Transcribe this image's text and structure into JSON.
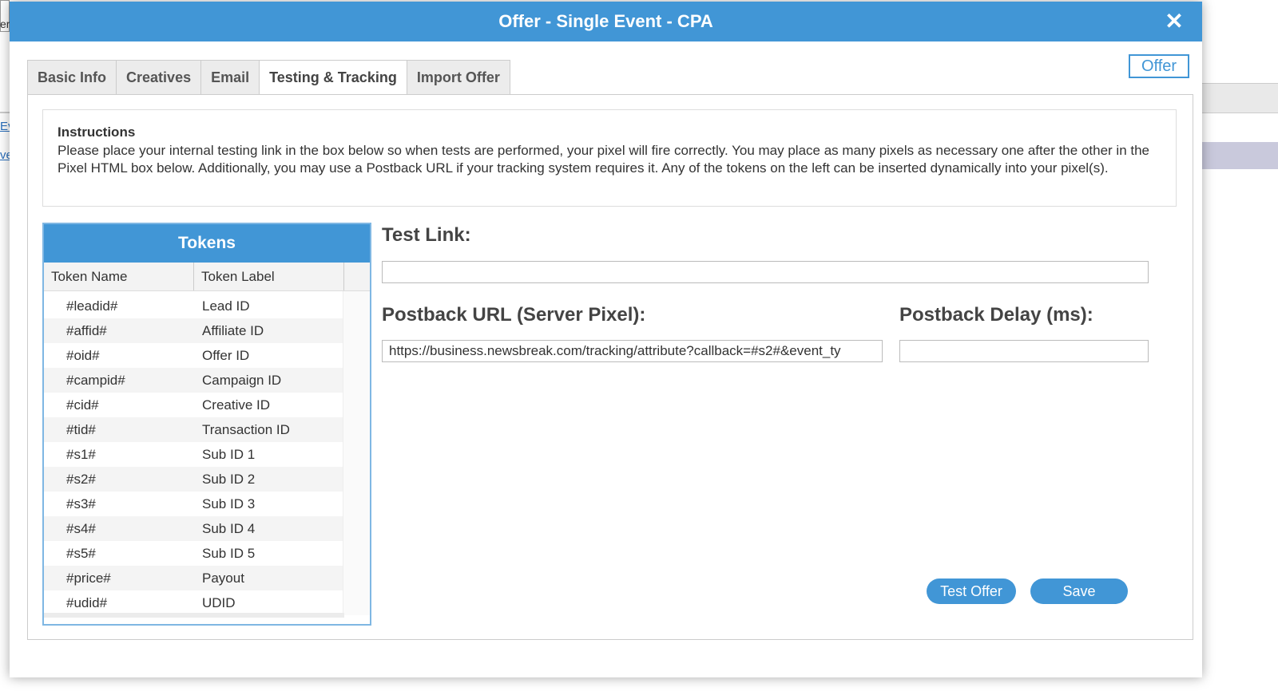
{
  "background": {
    "strip_text": "er",
    "link1": "Ev",
    "link2": "ve"
  },
  "modal": {
    "title": "Offer - Single Event - CPA",
    "close_icon": "close-icon",
    "offer_badge": "Offer",
    "tabs": [
      {
        "label": "Basic Info",
        "active": false
      },
      {
        "label": "Creatives",
        "active": false
      },
      {
        "label": "Email",
        "active": false
      },
      {
        "label": "Testing & Tracking",
        "active": true
      },
      {
        "label": "Import Offer",
        "active": false
      }
    ]
  },
  "instructions": {
    "title": "Instructions",
    "text": "Please place your internal testing link in the box below so when tests are performed, your pixel will fire correctly. You may place as many pixels as necessary one after the other in the Pixel HTML box below. Additionally, you may use a Postback URL if your tracking system requires it. Any of the tokens on the left can be inserted dynamically into your pixel(s)."
  },
  "tokens": {
    "title": "Tokens",
    "columns": [
      "Token Name",
      "Token Label"
    ],
    "rows": [
      {
        "name": "#leadid#",
        "label": "Lead ID"
      },
      {
        "name": "#affid#",
        "label": "Affiliate ID"
      },
      {
        "name": "#oid#",
        "label": "Offer ID"
      },
      {
        "name": "#campid#",
        "label": "Campaign ID"
      },
      {
        "name": "#cid#",
        "label": "Creative ID"
      },
      {
        "name": "#tid#",
        "label": "Transaction ID"
      },
      {
        "name": "#s1#",
        "label": "Sub ID 1"
      },
      {
        "name": "#s2#",
        "label": "Sub ID 2"
      },
      {
        "name": "#s3#",
        "label": "Sub ID 3"
      },
      {
        "name": "#s4#",
        "label": "Sub ID 4"
      },
      {
        "name": "#s5#",
        "label": "Sub ID 5"
      },
      {
        "name": "#price#",
        "label": "Payout"
      },
      {
        "name": "#udid#",
        "label": "UDID"
      }
    ]
  },
  "form": {
    "test_link_label": "Test Link:",
    "test_link_value": "",
    "postback_url_label": "Postback URL (Server Pixel):",
    "postback_url_value": "https://business.newsbreak.com/tracking/attribute?callback=#s2#&event_ty",
    "postback_delay_label": "Postback Delay (ms):",
    "postback_delay_value": ""
  },
  "buttons": {
    "test_offer": "Test Offer",
    "save": "Save"
  },
  "colors": {
    "accent": "#4196d6",
    "header_text": "#ffffff"
  }
}
